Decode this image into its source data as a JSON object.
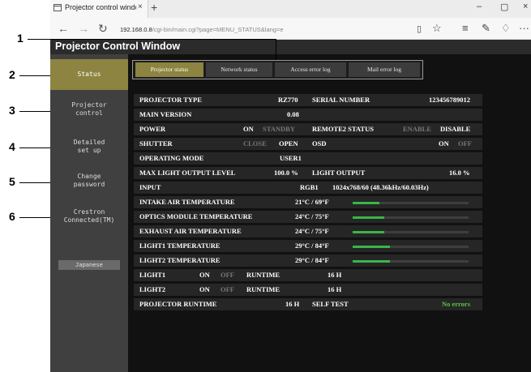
{
  "browser": {
    "tab_title": "Projector control windo",
    "tab_close": "×",
    "new_tab": "+",
    "address_host": "192.168.0.8",
    "address_rest": "/cgi-bin/main.cgi?page=MENU_STATUS&lang=e",
    "back": "←",
    "forward": "→",
    "refresh": "↻",
    "reading_view": "▯",
    "favorite": "☆",
    "hub": "≡",
    "notes": "✎",
    "share": "♢",
    "more": "···",
    "minimize": "–",
    "maximize": "▢",
    "close": "×"
  },
  "app": {
    "title": "Projector Control Window",
    "menu": [
      {
        "label": "Status"
      },
      {
        "label": "Projector\ncontrol"
      },
      {
        "label": "Detailed\nset up"
      },
      {
        "label": "Change\npassword"
      },
      {
        "label": "Crestron\nConnected(TM)"
      }
    ],
    "language_button": "Japanese",
    "tabs": [
      "Projector status",
      "Network status",
      "Access error log",
      "Mail error log"
    ]
  },
  "status": {
    "projector_type_label": "PROJECTOR TYPE",
    "projector_type": "RZ770",
    "serial_label": "SERIAL NUMBER",
    "serial": "123456789012",
    "main_version_label": "MAIN VERSION",
    "main_version": "0.08",
    "power_label": "POWER",
    "power_on": "ON",
    "power_standby": "STANDBY",
    "remote2_label": "REMOTE2 STATUS",
    "remote2_enable": "ENABLE",
    "remote2_disable": "DISABLE",
    "shutter_label": "SHUTTER",
    "shutter_close": "CLOSE",
    "shutter_open": "OPEN",
    "osd_label": "OSD",
    "osd_on": "ON",
    "osd_off": "OFF",
    "operating_mode_label": "OPERATING MODE",
    "operating_mode": "USER1",
    "max_light_label": "MAX LIGHT OUTPUT LEVEL",
    "max_light": "100.0 %",
    "light_output_label": "LIGHT OUTPUT",
    "light_output": "16.0 %",
    "input_label": "INPUT",
    "input_value": "RGB1",
    "input_signal": "1024x768/60 (48.36kHz/60.03Hz)",
    "temperatures": [
      {
        "label": "INTAKE AIR TEMPERATURE",
        "value": "21°C / 69°F",
        "level": 0.23
      },
      {
        "label": "OPTICS MODULE TEMPERATURE",
        "value": "24°C / 75°F",
        "level": 0.27
      },
      {
        "label": "EXHAUST AIR TEMPERATURE",
        "value": "24°C / 75°F",
        "level": 0.27
      },
      {
        "label": "LIGHT1 TEMPERATURE",
        "value": "29°C / 84°F",
        "level": 0.32
      },
      {
        "label": "LIGHT2 TEMPERATURE",
        "value": "29°C / 84°F",
        "level": 0.32
      }
    ],
    "light1_label": "LIGHT1",
    "light1_on": "ON",
    "light1_off": "OFF",
    "light1_runtime_label": "RUNTIME",
    "light1_runtime": "16 H",
    "light2_label": "LIGHT2",
    "light2_on": "ON",
    "light2_off": "OFF",
    "light2_runtime_label": "RUNTIME",
    "light2_runtime": "16 H",
    "projector_runtime_label": "PROJECTOR RUNTIME",
    "projector_runtime": "16 H",
    "self_test_label": "SELF TEST",
    "self_test": "No errors"
  },
  "callouts": [
    "1",
    "2",
    "3",
    "4",
    "5",
    "6"
  ]
}
